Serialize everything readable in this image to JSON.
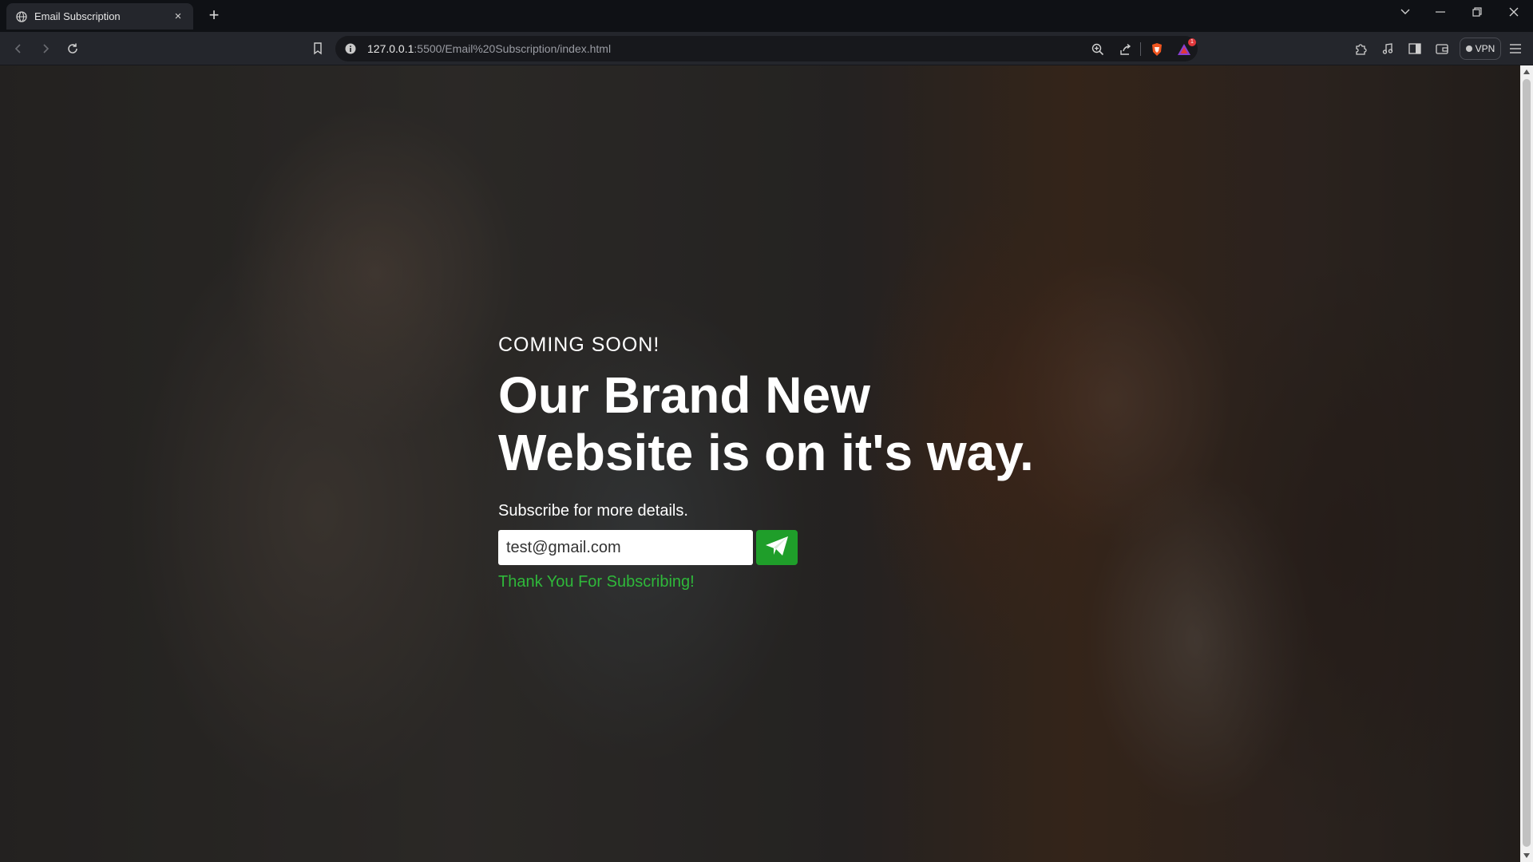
{
  "browser": {
    "tab": {
      "title": "Email Subscription",
      "close": "×"
    },
    "new_tab": "+",
    "address": {
      "host": "127.0.0.1",
      "path": ":5500/Email%20Subscription/index.html"
    },
    "shields_badge": "1",
    "vpn_label": "VPN"
  },
  "page": {
    "eyebrow": "COMING SOON!",
    "headline_line1": "Our Brand New",
    "headline_line2": "Website is on it's way.",
    "subtext": "Subscribe for more details.",
    "email_value": "test@gmail.com",
    "success_message": "Thank You For Subscribing!"
  },
  "colors": {
    "accent_green": "#1f9e2a",
    "success_text": "#2fb83a",
    "browser_dark": "#0f1115",
    "toolbar": "#24262c"
  },
  "icons": [
    "globe-icon",
    "close-icon",
    "plus-icon",
    "chevron-down-icon",
    "minimize-icon",
    "restore-icon",
    "back-icon",
    "forward-icon",
    "reload-icon",
    "bookmark-icon",
    "info-icon",
    "zoom-icon",
    "share-icon",
    "brave-shield-icon",
    "rewards-icon",
    "extensions-icon",
    "media-icon",
    "sidebar-icon",
    "wallet-icon",
    "menu-icon",
    "send-icon"
  ]
}
